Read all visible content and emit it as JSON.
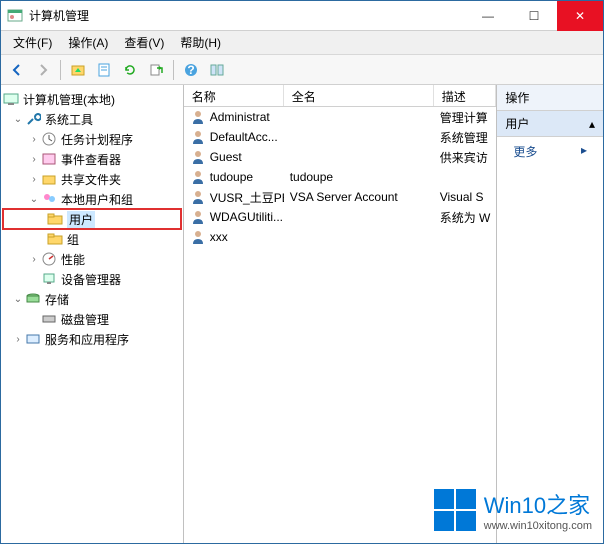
{
  "window": {
    "title": "计算机管理",
    "min": "—",
    "max": "☐",
    "close": "✕"
  },
  "menu": {
    "file": "文件(F)",
    "action": "操作(A)",
    "view": "查看(V)",
    "help": "帮助(H)"
  },
  "tree": {
    "root": "计算机管理(本地)",
    "systools": "系统工具",
    "tasksched": "任务计划程序",
    "eventviewer": "事件查看器",
    "sharedfolders": "共享文件夹",
    "localusers": "本地用户和组",
    "users": "用户",
    "groups": "组",
    "perf": "性能",
    "devmgr": "设备管理器",
    "storage": "存储",
    "diskmgr": "磁盘管理",
    "services": "服务和应用程序"
  },
  "cols": {
    "name": "名称",
    "fullname": "全名",
    "desc": "描述"
  },
  "users": [
    {
      "name": "Administrat",
      "full": "",
      "desc": "管理计算"
    },
    {
      "name": "DefaultAcc...",
      "full": "",
      "desc": "系统管理"
    },
    {
      "name": "Guest",
      "full": "",
      "desc": "供来宾访"
    },
    {
      "name": "tudoupe",
      "full": "tudoupe",
      "desc": ""
    },
    {
      "name": "VUSR_土豆PE",
      "full": "VSA Server Account",
      "desc": "Visual S"
    },
    {
      "name": "WDAGUtiliti...",
      "full": "",
      "desc": "系统为 W"
    },
    {
      "name": "xxx",
      "full": "",
      "desc": ""
    }
  ],
  "actions": {
    "header": "操作",
    "section": "用户",
    "more": "更多"
  },
  "watermark": {
    "text": "Win10之家",
    "url": "www.win10xitong.com"
  }
}
